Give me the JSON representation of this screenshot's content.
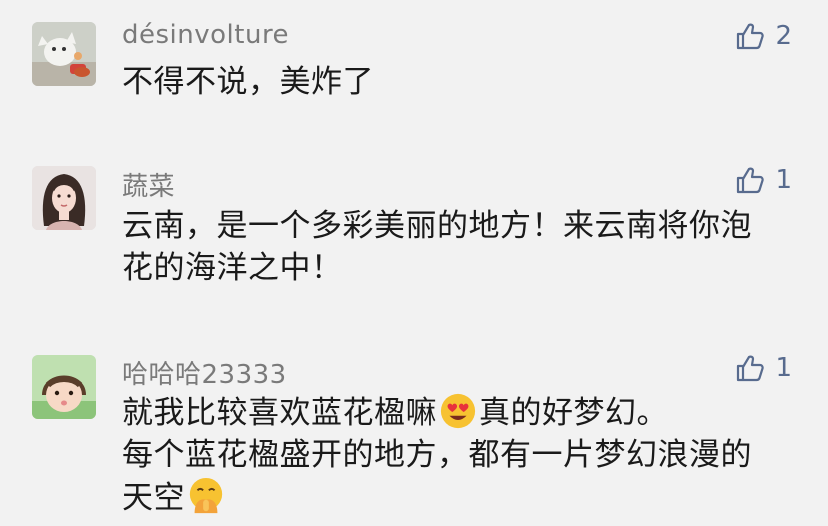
{
  "comments": [
    {
      "username": "désinvolture",
      "likes": "2",
      "lines": [
        "不得不说，美炸了"
      ]
    },
    {
      "username": "蔬菜",
      "likes": "1",
      "lines": [
        "云南，是一个多彩美丽的地方！来云南将你泡",
        "花的海洋之中！"
      ]
    },
    {
      "username": "哈哈哈23333",
      "likes": "1",
      "line1_before": "就我比较喜欢蓝花楹嘛",
      "line1_after": "真的好梦幻。",
      "line2": "每个蓝花楹盛开的地方，都有一片梦幻浪漫的",
      "line3": "天空"
    }
  ],
  "colors": {
    "background": "#f2f2f2",
    "like_blue": "#586b8e",
    "username_gray": "#7a7a7a",
    "text": "#1a1a1a"
  },
  "icons": [
    "thumbs-up-icon",
    "heart-eyes-emoji",
    "shushing-face-emoji"
  ]
}
